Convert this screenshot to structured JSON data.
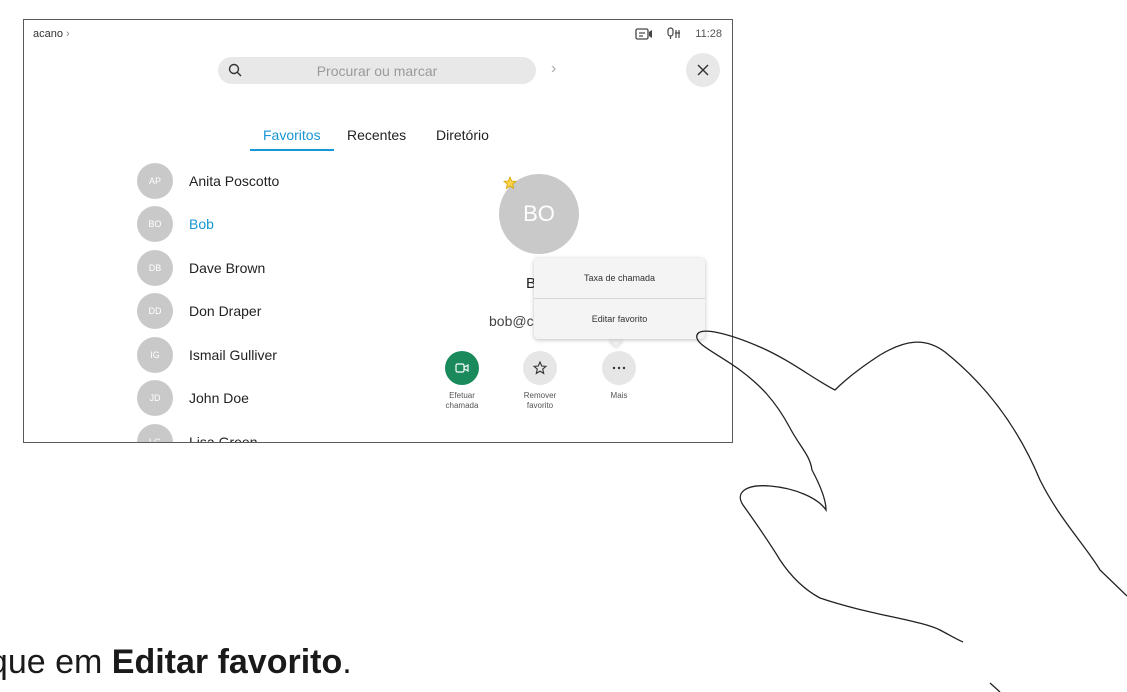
{
  "status_bar": {
    "user": "acano",
    "time": "11:28"
  },
  "search": {
    "placeholder": "Procurar ou marcar"
  },
  "tabs": [
    {
      "label": "Favoritos",
      "active": true
    },
    {
      "label": "Recentes",
      "active": false
    },
    {
      "label": "Diretório",
      "active": false
    }
  ],
  "contacts": [
    {
      "initials": "AP",
      "name": "Anita Poscotto"
    },
    {
      "initials": "BO",
      "name": "Bob",
      "selected": true
    },
    {
      "initials": "DB",
      "name": "Dave Brown"
    },
    {
      "initials": "DD",
      "name": "Don Draper"
    },
    {
      "initials": "IG",
      "name": "Ismail Gulliver"
    },
    {
      "initials": "JD",
      "name": "John Doe"
    },
    {
      "initials": "LG",
      "name": "Lisa Green"
    }
  ],
  "detail": {
    "initials": "BO",
    "name": "B",
    "email": "bob@c"
  },
  "popover_menu": [
    {
      "label": "Taxa de chamada"
    },
    {
      "label": "Editar favorito"
    }
  ],
  "actions": [
    {
      "label_line1": "Efetuar",
      "label_line2": "chamada",
      "icon": "video-icon"
    },
    {
      "label_line1": "Remover",
      "label_line2": "favorito",
      "icon": "star-icon"
    },
    {
      "label_line1": "Mais",
      "label_line2": "",
      "icon": "more-icon"
    }
  ],
  "caption": {
    "prefix": "oque em ",
    "strong": "Editar favorito",
    "suffix": "."
  },
  "colors": {
    "accent": "#1795d4",
    "call_green": "#1a8a5c",
    "avatar_gray": "#c9c9c9"
  }
}
